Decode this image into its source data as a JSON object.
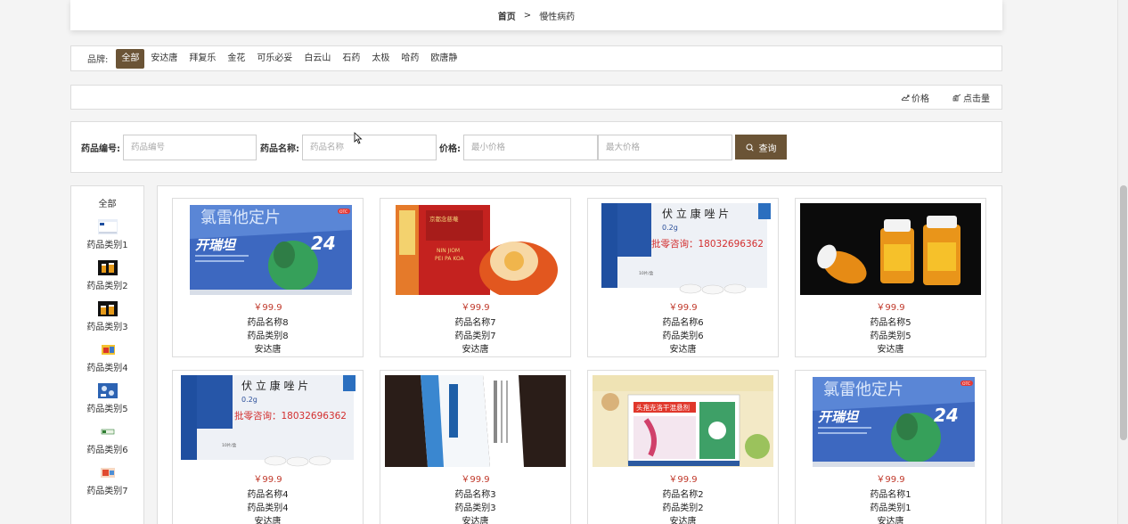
{
  "breadcrumb": {
    "home": "首页",
    "sep": ">",
    "current": "慢性病药"
  },
  "brand_filter": {
    "label": "品牌:",
    "brands": [
      "全部",
      "安达唐",
      "拜复乐",
      "金花",
      "可乐必妥",
      "白云山",
      "石药",
      "太极",
      "哈药",
      "欧唐静"
    ]
  },
  "sort": {
    "price": "价格",
    "clicks": "点击量"
  },
  "search": {
    "code_label": "药品编号:",
    "code_placeholder": "药品编号",
    "name_label": "药品名称:",
    "name_placeholder": "药品名称",
    "price_label": "价格:",
    "min_placeholder": "最小价格",
    "max_placeholder": "最大价格",
    "button": "查询"
  },
  "categories": {
    "all": "全部",
    "items": [
      "药品类别1",
      "药品类别2",
      "药品类别3",
      "药品类别4",
      "药品类别5",
      "药品类别6",
      "药品类别7"
    ]
  },
  "products": [
    {
      "price": "￥99.9",
      "name": "药品名称8",
      "category": "药品类别8",
      "brand": "安达唐",
      "image_title": "氯雷他定片",
      "image_brand": "开瑞坦",
      "image_badge": "OTC",
      "image_num": "24"
    },
    {
      "price": "￥99.9",
      "name": "药品名称7",
      "category": "药品类别7",
      "brand": "安达唐",
      "image_title": "京都念慈菴",
      "image_sub": "NIN JIOM",
      "image_sub2": "PEI PA KOA"
    },
    {
      "price": "￥99.9",
      "name": "药品名称6",
      "category": "药品类别6",
      "brand": "安达唐",
      "image_title": "伏 立 康 唑 片",
      "image_dose": "0.2g",
      "image_phone": "批零咨询：18032696362",
      "image_count": "10片/盒"
    },
    {
      "price": "￥99.9",
      "name": "药品名称5",
      "category": "药品类别5",
      "brand": "安达唐"
    },
    {
      "price": "￥99.9",
      "name": "药品名称4",
      "category": "药品类别4",
      "brand": "安达唐",
      "image_title": "伏 立 康 唑 片",
      "image_dose": "0.2g",
      "image_phone": "批零咨询：18032696362",
      "image_count": "10片/盒"
    },
    {
      "price": "￥99.9",
      "name": "药品名称3",
      "category": "药品类别3",
      "brand": "安达唐"
    },
    {
      "price": "￥99.9",
      "name": "药品名称2",
      "category": "药品类别2",
      "brand": "安达唐",
      "image_title": "头孢克洛干混悬剂"
    },
    {
      "price": "￥99.9",
      "name": "药品名称1",
      "category": "药品类别1",
      "brand": "安达唐",
      "image_title": "氯雷他定片",
      "image_brand": "开瑞坦",
      "image_badge": "OTC",
      "image_num": "24"
    }
  ],
  "colors": {
    "accent": "#6b5436",
    "price": "#c0392b"
  }
}
